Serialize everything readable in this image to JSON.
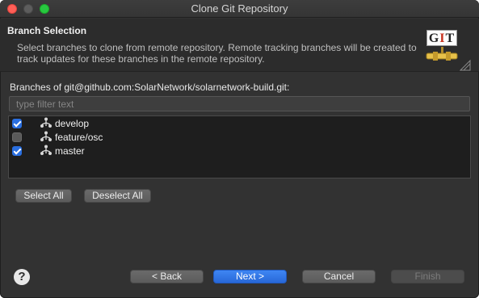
{
  "window": {
    "title": "Clone Git Repository"
  },
  "header": {
    "title": "Branch Selection",
    "description": "Select branches to clone from remote repository. Remote tracking branches will be created to track updates for these branches in the remote repository.",
    "logo_text": {
      "g": "G",
      "i": "I",
      "t": "T"
    }
  },
  "branches": {
    "label": "Branches of git@github.com:SolarNetwork/solarnetwork-build.git:",
    "filter_placeholder": "type filter text",
    "items": [
      {
        "label": "develop",
        "checked": true
      },
      {
        "label": "feature/osc",
        "checked": false
      },
      {
        "label": "master",
        "checked": true
      }
    ],
    "select_all_label": "Select All",
    "deselect_all_label": "Deselect All"
  },
  "footer": {
    "help_glyph": "?",
    "back_label": "< Back",
    "next_label": "Next >",
    "cancel_label": "Cancel",
    "finish_label": "Finish"
  },
  "colors": {
    "accent": "#2a6fe0",
    "close": "#ff5f57",
    "maximize": "#28c840"
  }
}
